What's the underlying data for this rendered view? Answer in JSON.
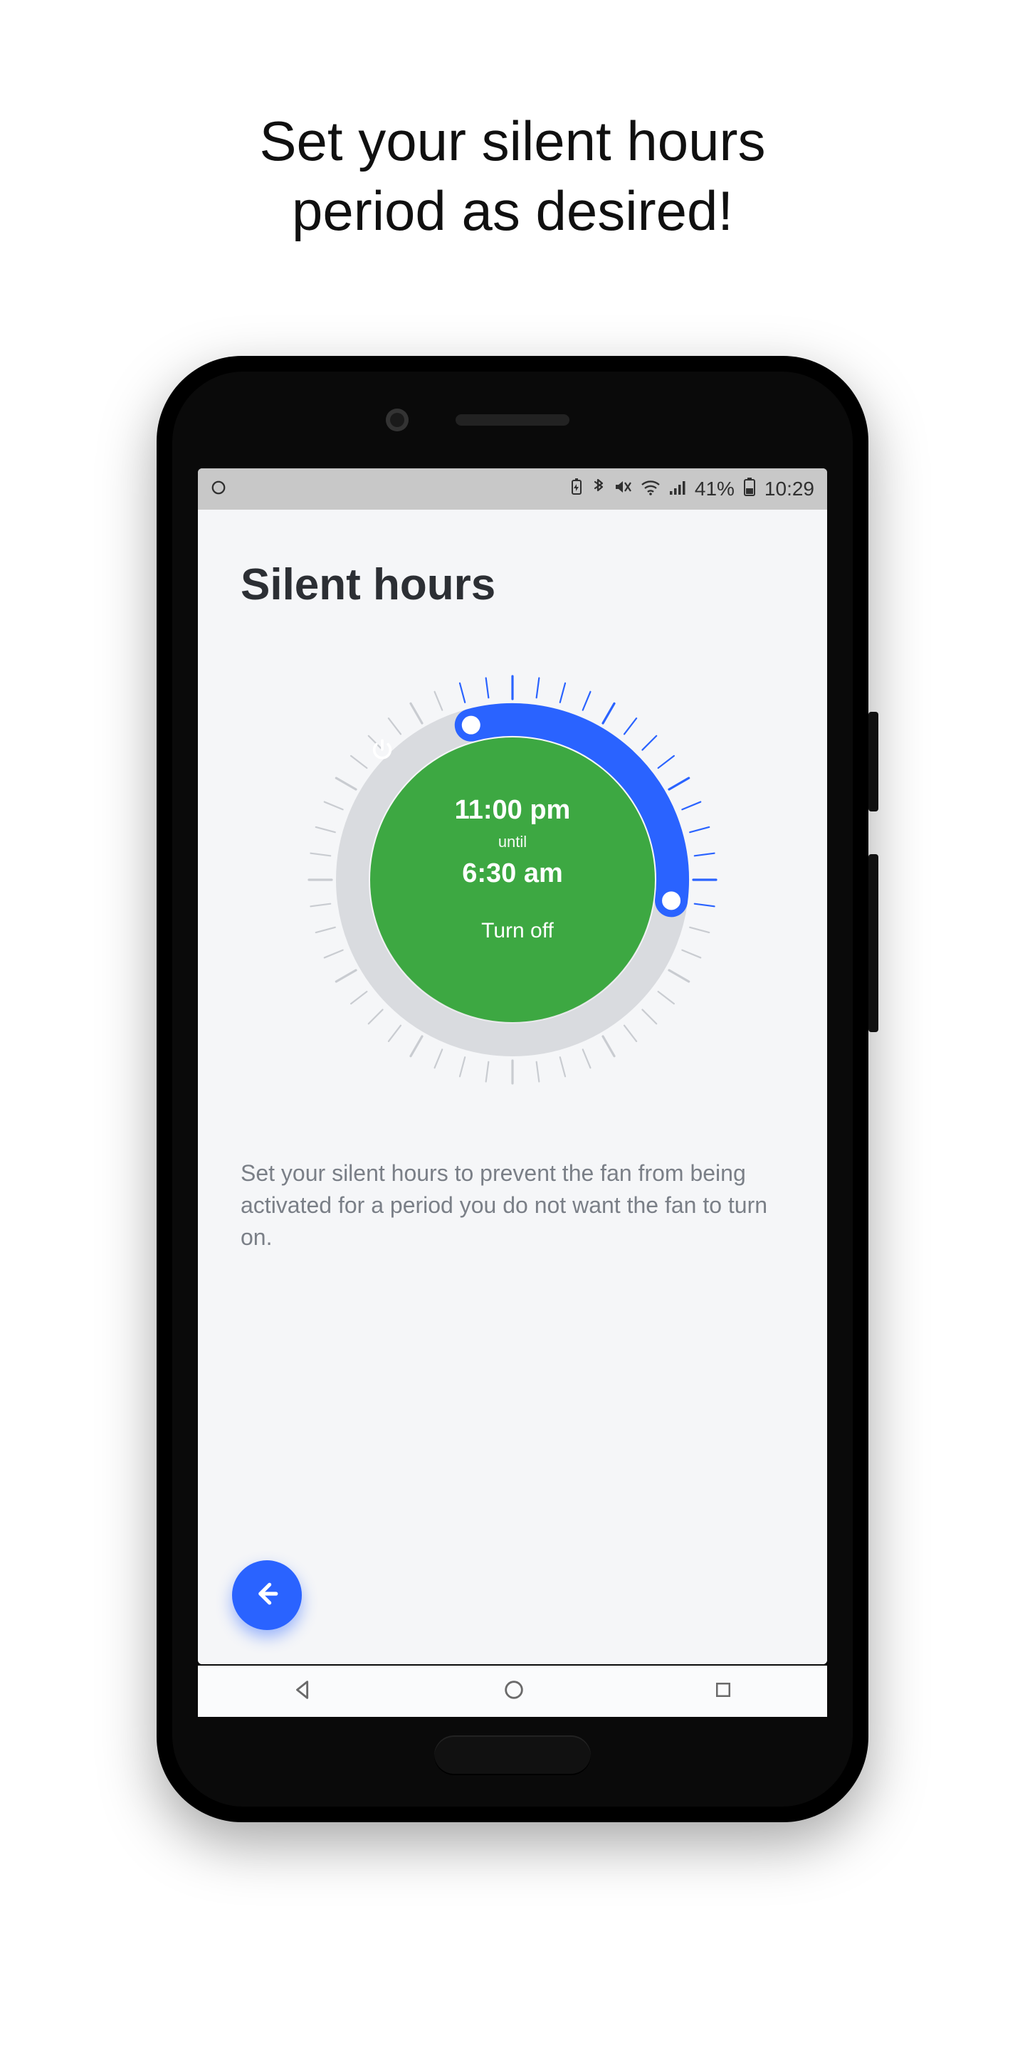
{
  "promo": {
    "line1": "Set your silent hours",
    "line2": "period as desired!"
  },
  "statusbar": {
    "battery_pct": "41%",
    "time": "10:29"
  },
  "page": {
    "title": "Silent hours",
    "description": "Set your silent hours to prevent the fan from being activated for a period  you do not want the fan to turn on."
  },
  "dial": {
    "start_time": "11:00 pm",
    "until_label": "until",
    "end_time": "6:30 am",
    "turnoff_label": "Turn off",
    "arc_start_deg": 345,
    "arc_end_deg": 97.5
  },
  "colors": {
    "accent_blue": "#2a63ff",
    "dial_green": "#3da842",
    "track_grey": "#d9dbdf",
    "tick_grey": "#c9ccd1",
    "tick_active": "#2a63ff"
  }
}
